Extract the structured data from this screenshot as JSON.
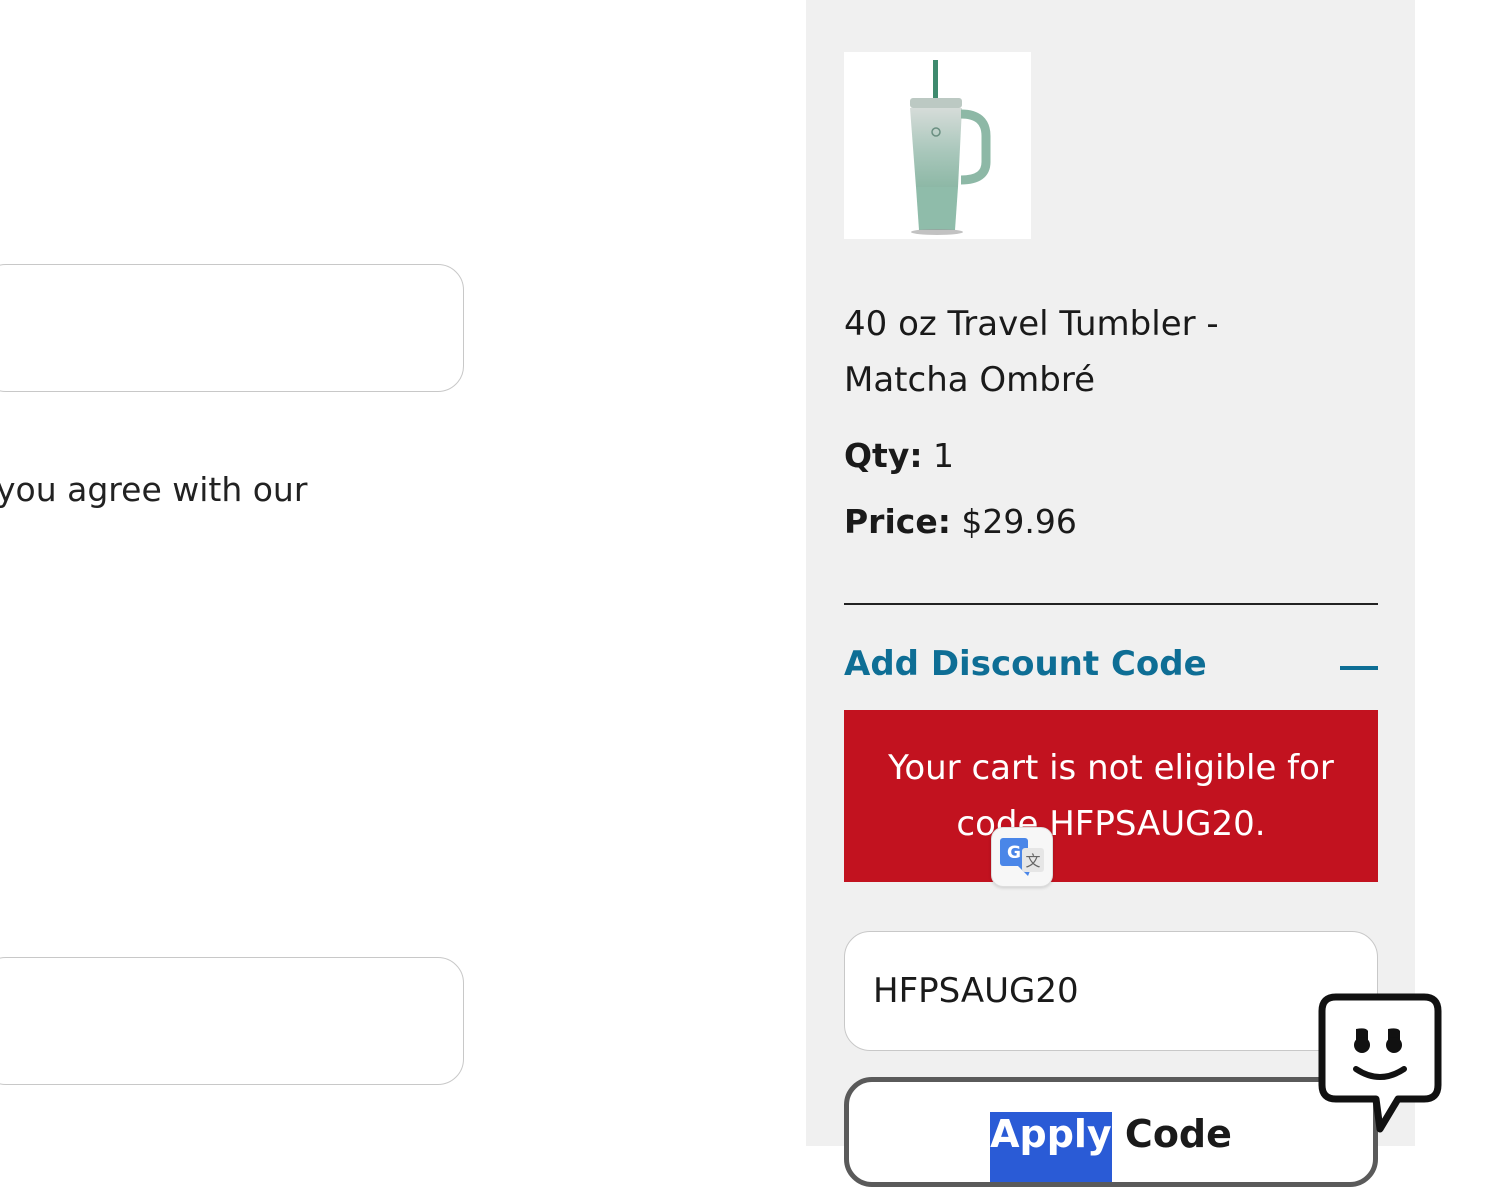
{
  "form": {
    "consent_text": "you agree with our"
  },
  "order_summary": {
    "product": {
      "image_icon": "tumbler-image",
      "name_line1": "40 oz Travel Tumbler -",
      "name_line2": "Matcha Ombré",
      "qty_label": "Qty:",
      "qty_value": "1",
      "price_label": "Price:",
      "price_value": "$29.96"
    },
    "discount": {
      "toggle_label": "Add Discount Code",
      "toggle_icon": "minus-icon",
      "error_line1": "Your cart is not eligible for",
      "error_line2": "code HFPSAUG20.",
      "input_value": "HFPSAUG20",
      "apply_label_selected": "Apply",
      "apply_label_rest": " Code"
    }
  },
  "colors": {
    "panel_bg": "#f0f0f0",
    "link_accent": "#0e6e95",
    "error_bg": "#c2121f",
    "selection": "#2a5bd6"
  },
  "icons": {
    "translate": "google-translate-icon",
    "chat": "chat-quote-icon"
  }
}
